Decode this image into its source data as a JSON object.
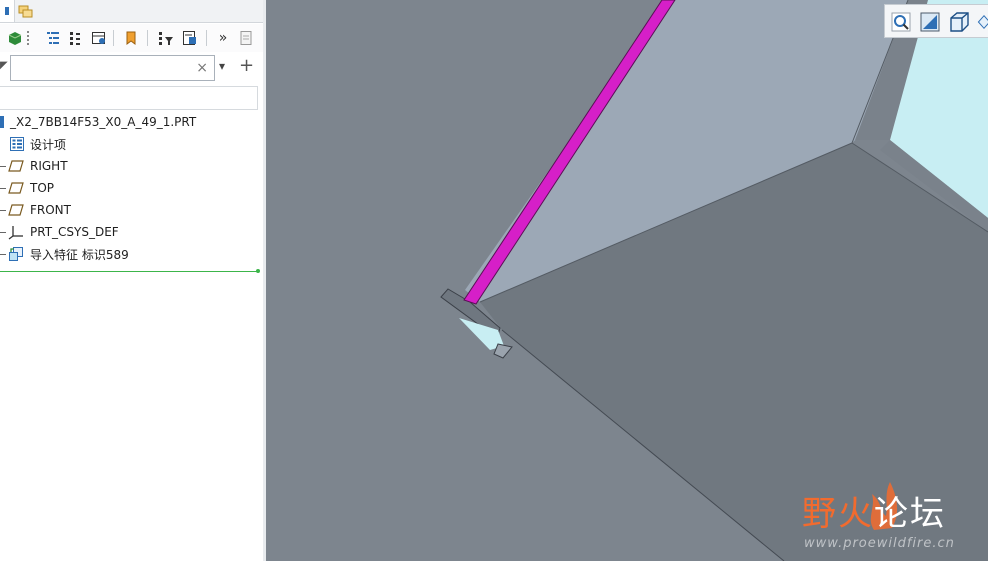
{
  "search": {
    "value": "",
    "placeholder": "",
    "clear_glyph": "×"
  },
  "toolbar": {
    "more_glyph": "»",
    "add_glyph": "+",
    "dropdown_glyph": "▾",
    "buttons": [
      "display-part-icon",
      "tree-columns-icon",
      "show-tree-icon",
      "layer-view-icon",
      "highlight-icon",
      "tree-filter-icon",
      "settings-icon",
      "more-icon",
      "notes-icon"
    ]
  },
  "tree": {
    "root": "_X2_7BB14F53_X0_A_49_1.PRT",
    "items": [
      {
        "label": "设计项",
        "icon": "design-items-icon"
      },
      {
        "label": "RIGHT",
        "icon": "datum-plane-icon"
      },
      {
        "label": "TOP",
        "icon": "datum-plane-icon"
      },
      {
        "label": "FRONT",
        "icon": "datum-plane-icon"
      },
      {
        "label": "PRT_CSYS_DEF",
        "icon": "coordinate-system-icon"
      },
      {
        "label": "导入特征 标识589",
        "icon": "import-feature-icon"
      }
    ]
  },
  "watermark": {
    "title_accent": "野火",
    "title_rest": "论坛",
    "url": "www.proewildfire.cn"
  },
  "colors": {
    "highlight_edge": "#d61fc8",
    "model_dark": "#6f7780",
    "model_light": "#9aa6b3",
    "background": "#7d858e",
    "accent": "#f26b2e"
  }
}
